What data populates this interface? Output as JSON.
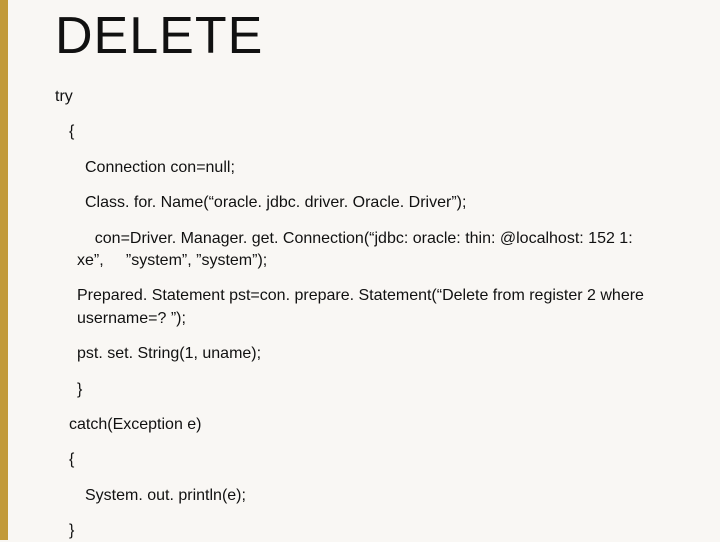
{
  "title": "DELETE",
  "lines": {
    "l0": "try",
    "l1": "{",
    "l2": "Connection con=null;",
    "l3": "Class. for. Name(“oracle. jdbc. driver. Oracle. Driver”);",
    "l4": "    con=Driver. Manager. get. Connection(“jdbc: oracle: thin: @localhost: 152 1: xe”,     ”system”, ”system”);",
    "l5": "Prepared. Statement pst=con. prepare. Statement(“Delete from register 2 where username=? ”);",
    "l6": "pst. set. String(1, uname);",
    "l7": "}",
    "l8": "catch(Exception e)",
    "l9": "{",
    "l10": "System. out. println(e);",
    "l11": "}"
  }
}
